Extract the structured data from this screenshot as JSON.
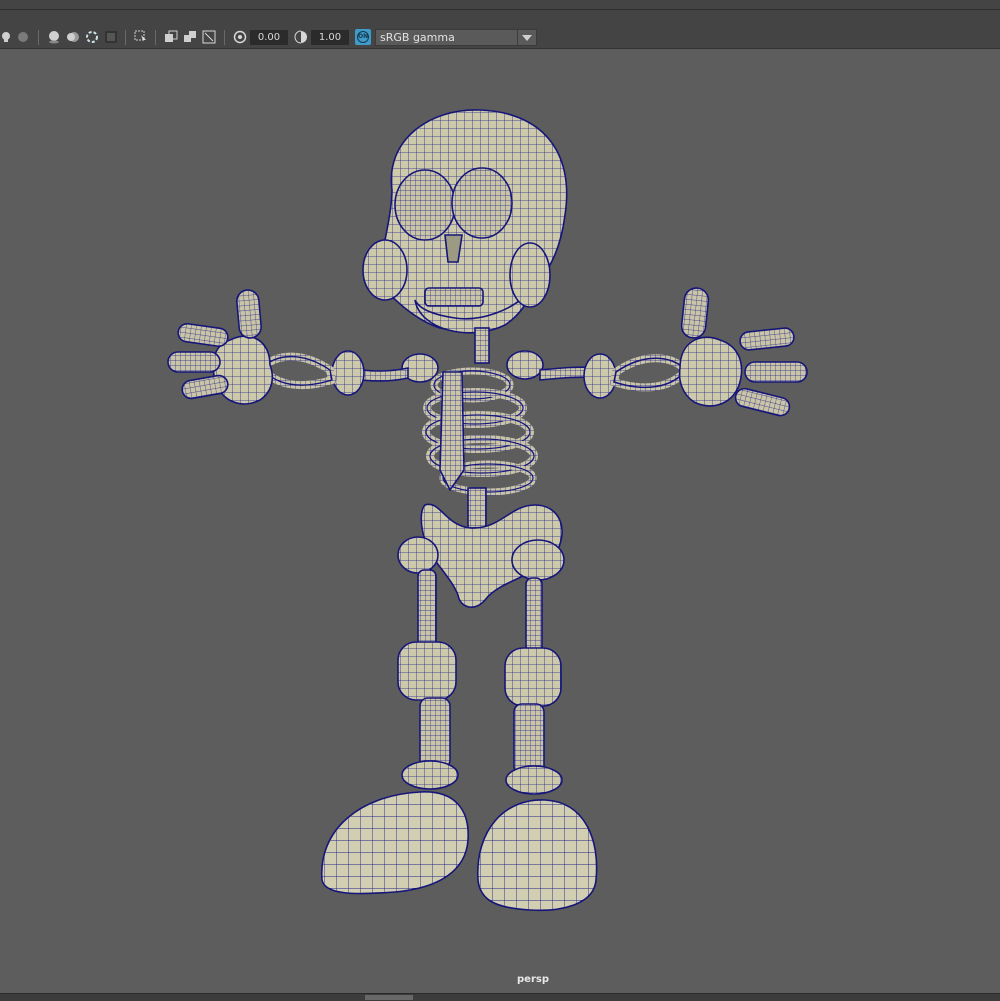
{
  "toolbar": {
    "icons": [
      "light-bulb-icon",
      "shadow-sphere-icon",
      "ambient-occlusion-icon",
      "motion-blur-icon",
      "anti-alias-icon",
      "isolate-select-icon",
      "xray-icon",
      "xray-joints-icon",
      "xray-active-icon",
      "wireframe-on-shaded-icon",
      "exposure-icon",
      "gamma-icon"
    ],
    "exposure_value": "0.00",
    "gamma_value": "1.00",
    "color_management_badge": "ON",
    "color_space": "sRGB gamma"
  },
  "viewport": {
    "camera_label": "persp",
    "scene_object": "skeleton-character-wireframe"
  },
  "colors": {
    "background": "#5d5d5d",
    "panel": "#444444",
    "wireframe": "#1b1b8a",
    "mesh_fill": "#c9c5a8",
    "accent": "#3f9bc9"
  }
}
